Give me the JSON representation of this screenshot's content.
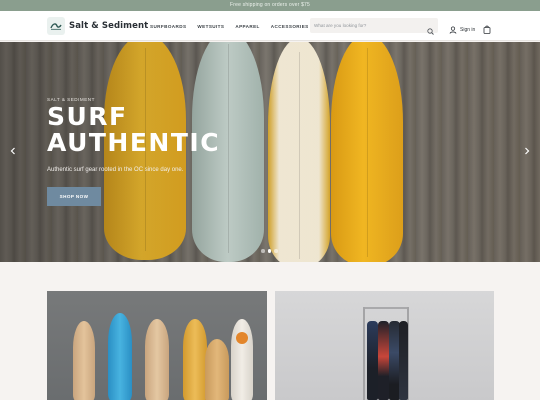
{
  "announcement": "Free shipping on orders over $75",
  "header": {
    "brand": "Salt & Sediment",
    "nav": [
      "SURFBOARDS",
      "WETSUITS",
      "APPAREL",
      "ACCESSORIES"
    ],
    "search_placeholder": "What are you looking for?",
    "signin_label": "Sign in"
  },
  "hero": {
    "subheading": "SALT & SEDIMENT",
    "title": "SURF AUTHENTIC",
    "description": "Authentic surf gear rooted in the OC since day one.",
    "cta": "SHOP NOW",
    "slides": 3,
    "active_slide": 2
  },
  "colors": {
    "announcement_bg": "#8a9e8e",
    "cta_bg": "#6f8aa0",
    "page_bg": "#f6f3f1"
  },
  "icons": [
    "logo-icon",
    "search-icon",
    "user-icon",
    "cart-icon",
    "chevron-left-icon",
    "chevron-right-icon"
  ]
}
